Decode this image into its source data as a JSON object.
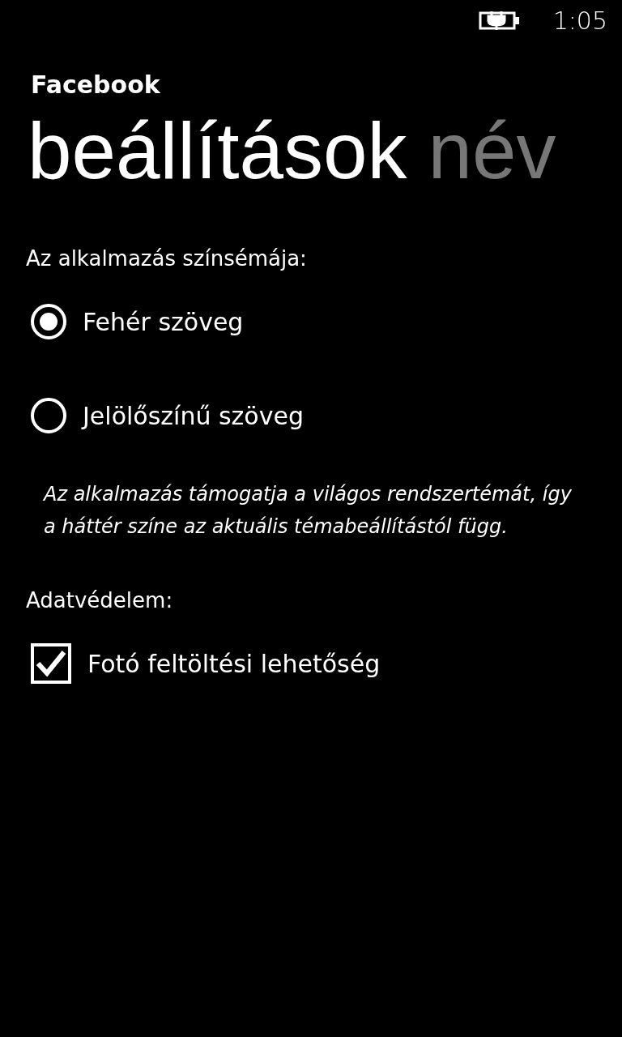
{
  "status_bar": {
    "time": "1:05",
    "charging": true
  },
  "app_title": "Facebook",
  "pivot": [
    {
      "label": "beállítások",
      "selected": true
    },
    {
      "label": "név",
      "selected": false
    }
  ],
  "sections": [
    {
      "heading": "Az alkalmazás színsémája:",
      "items": [
        {
          "kind": "radio",
          "label": "Fehér szöveg",
          "selected": true
        },
        {
          "kind": "radio",
          "label": "Jelölőszínű szöveg",
          "selected": false
        },
        {
          "kind": "note",
          "text": "Az alkalmazás támogatja a világos rendszertémát, így a háttér színe az aktuális témabeállítástól függ."
        }
      ]
    },
    {
      "heading": "Adatvédelem:",
      "items": [
        {
          "kind": "checkbox",
          "label": "Fotó feltöltési lehetőség",
          "checked": true
        }
      ]
    }
  ]
}
